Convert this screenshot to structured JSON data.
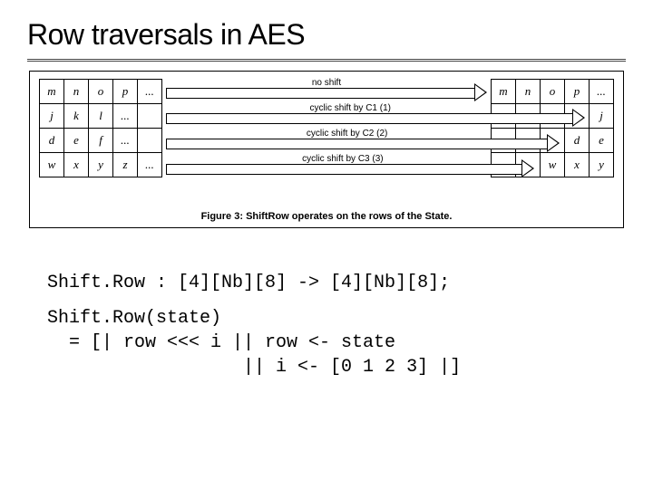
{
  "title": "Row traversals in AES",
  "figure": {
    "caption": "Figure 3: ShiftRow operates on the rows of the State.",
    "left_table": [
      [
        "m",
        "n",
        "o",
        "p",
        "..."
      ],
      [
        "j",
        "k",
        "l",
        "...",
        ""
      ],
      [
        "d",
        "e",
        "f",
        "...",
        ""
      ],
      [
        "w",
        "x",
        "y",
        "z",
        "..."
      ]
    ],
    "right_table": [
      [
        "m",
        "n",
        "o",
        "p",
        "..."
      ],
      [
        "",
        "",
        "",
        "",
        "j"
      ],
      [
        "",
        "",
        "",
        "d",
        "e"
      ],
      [
        "",
        "",
        "w",
        "x",
        "y"
      ]
    ],
    "arrows": [
      {
        "label": "no shift"
      },
      {
        "label": "cyclic shift by C1 (1)"
      },
      {
        "label": "cyclic shift by C2 (2)"
      },
      {
        "label": "cyclic shift by C3 (3)"
      }
    ]
  },
  "code": {
    "line1": "Shift.Row : [4][Nb][8] -> [4][Nb][8];",
    "line2": "Shift.Row(state)",
    "line3": "  = [| row <<< i || row <- state",
    "line4": "                  || i <- [0 1 2 3] |]"
  }
}
